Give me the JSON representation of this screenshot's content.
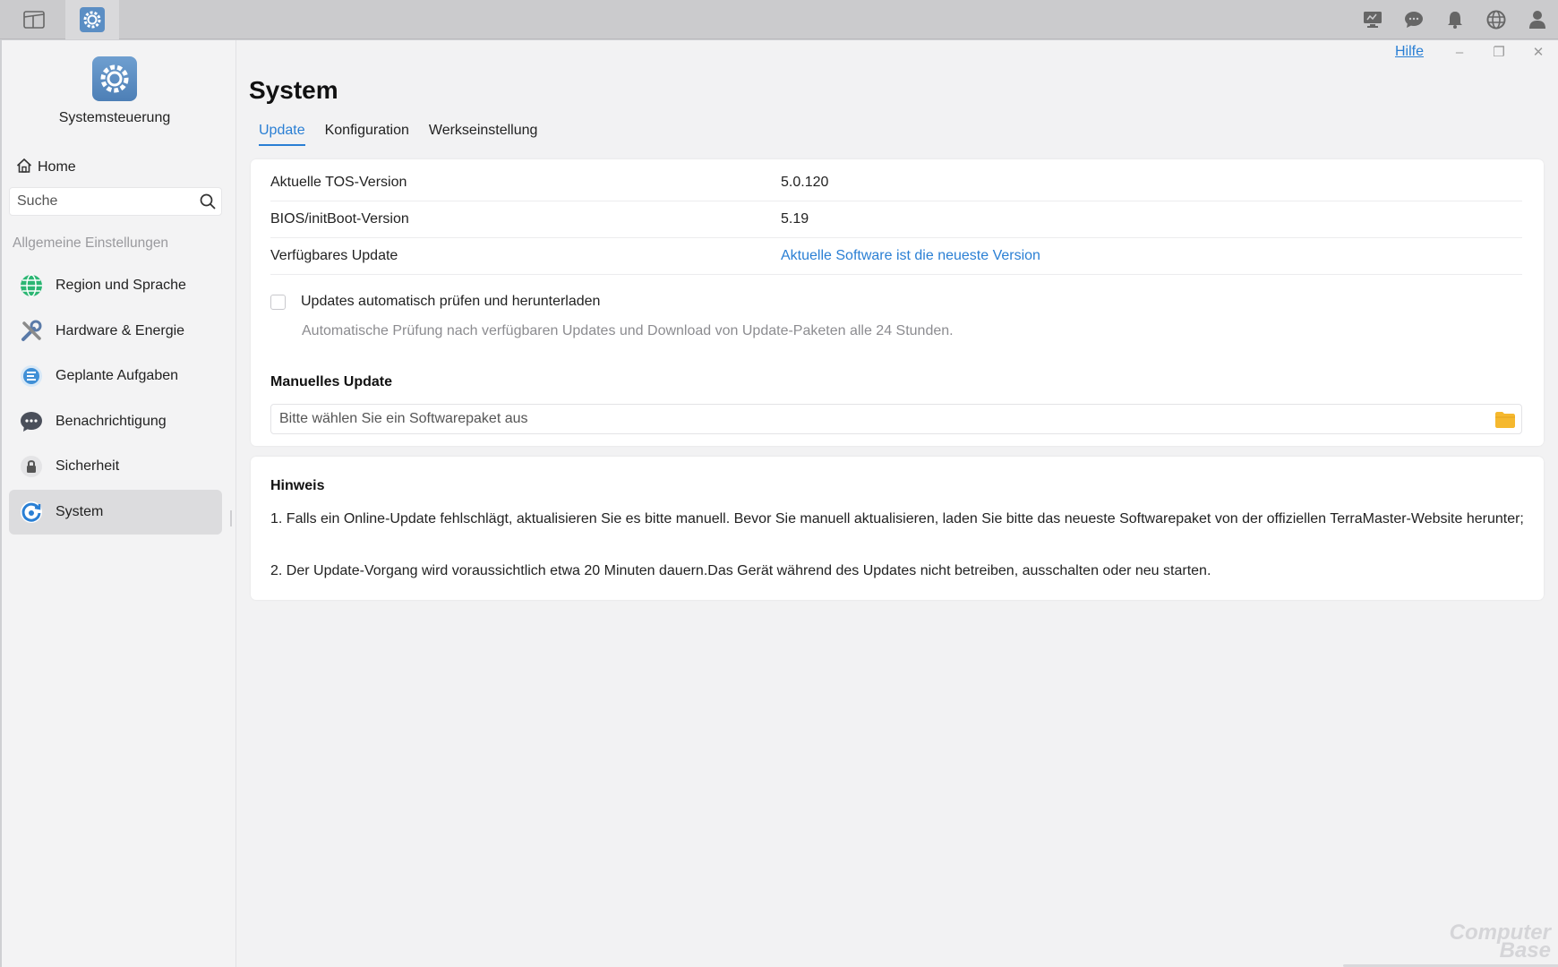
{
  "taskbar": {
    "left_icons": [
      "window-icon",
      "settings-icon"
    ],
    "right_icons": [
      "monitor-icon",
      "chat-icon",
      "bell-icon",
      "globe-icon",
      "user-icon"
    ]
  },
  "sidebar": {
    "app_name": "Systemsteuerung",
    "home_label": "Home",
    "search_placeholder": "Suche",
    "section_label": "Allgemeine Einstellungen",
    "items": [
      {
        "label": "Region und Sprache",
        "icon": "globe-icon"
      },
      {
        "label": "Hardware & Energie",
        "icon": "tools-icon"
      },
      {
        "label": "Geplante Aufgaben",
        "icon": "tasks-icon"
      },
      {
        "label": "Benachrichtigung",
        "icon": "message-icon"
      },
      {
        "label": "Sicherheit",
        "icon": "lock-icon"
      },
      {
        "label": "System",
        "icon": "system-icon"
      }
    ]
  },
  "window_controls": {
    "help_label": "Hilfe",
    "minimize": "–",
    "restore": "❐",
    "close": "✕"
  },
  "main": {
    "title": "System",
    "tabs": [
      {
        "label": "Update",
        "active": true
      },
      {
        "label": "Konfiguration",
        "active": false
      },
      {
        "label": "Werkseinstellung",
        "active": false
      }
    ],
    "info": [
      {
        "label": "Aktuelle TOS-Version",
        "value": "5.0.120"
      },
      {
        "label": "BIOS/initBoot-Version",
        "value": "5.19"
      },
      {
        "label": "Verfügbares Update",
        "value": "Aktuelle Software ist die neueste Version"
      }
    ],
    "auto_update_label": "Updates automatisch prüfen und herunterladen",
    "auto_update_checked": false,
    "auto_update_desc": "Automatische Prüfung nach verfügbaren Updates und Download von Update-Paketen alle 24 Stunden.",
    "manual_title": "Manuelles Update",
    "file_placeholder": "Bitte wählen Sie ein Softwarepaket aus",
    "note_title": "Hinweis",
    "notes": [
      "1. Falls ein Online-Update fehlschlägt, aktualisieren Sie es bitte manuell. Bevor Sie manuell aktualisieren, laden Sie bitte das neueste Softwarepaket von der offiziellen TerraMaster-Website herunter;",
      "2. Der Update-Vorgang wird voraussichtlich etwa 20 Minuten dauern.Das Gerät während des Updates nicht betreiben, ausschalten oder neu starten."
    ]
  },
  "watermark": {
    "line1": "Computer",
    "line2": "Base"
  },
  "colors": {
    "accent": "#2a7fd4",
    "folder": "#f5b82e"
  }
}
